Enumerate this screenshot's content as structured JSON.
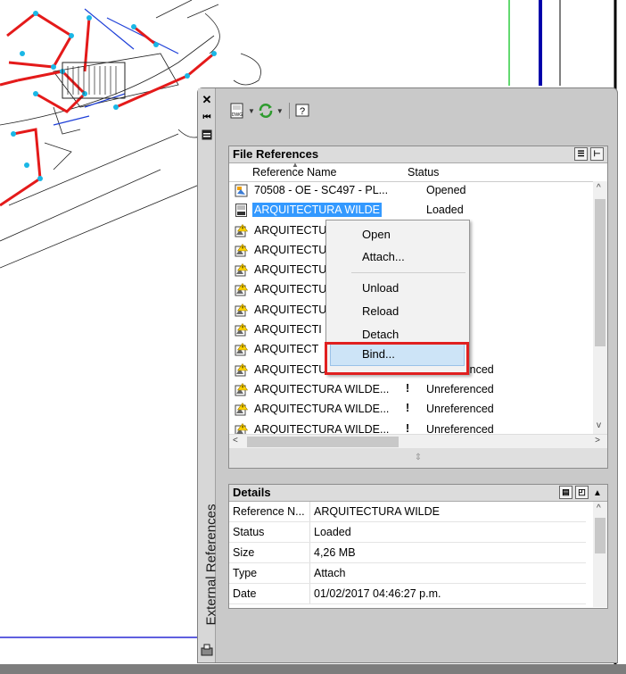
{
  "palette": {
    "title": "External References",
    "toolbar": {
      "attach_icon_text": "DWG",
      "help_glyph": "?"
    },
    "colors": {
      "selection": "#3399ff",
      "highlight_border": "#e02020",
      "drawing_red": "#e41a1a",
      "drawing_blue": "#1e3fd8",
      "drawing_cyan": "#1ab7e6"
    }
  },
  "file_references": {
    "title": "File References",
    "columns": {
      "name": "Reference Name",
      "status": "Status"
    },
    "rows": [
      {
        "name": "70508 - OE - SC497 - PL...",
        "status": "Opened",
        "warn": "",
        "icon": "dwg-host-icon"
      },
      {
        "name": "ARQUITECTURA WILDE",
        "status": "Loaded",
        "warn": "",
        "icon": "dwg-ref-icon",
        "selected": true
      },
      {
        "name": "ARQUITECTU",
        "status": "renced",
        "warn": "",
        "icon": "warning-ref-icon"
      },
      {
        "name": "ARQUITECTU",
        "status": "renced",
        "warn": "",
        "icon": "warning-ref-icon"
      },
      {
        "name": "ARQUITECTU",
        "status": "renced",
        "warn": "",
        "icon": "warning-ref-icon"
      },
      {
        "name": "ARQUITECTU",
        "status": "renced",
        "warn": "",
        "icon": "warning-ref-icon"
      },
      {
        "name": "ARQUITECTU",
        "status": "renced",
        "warn": "",
        "icon": "warning-ref-icon"
      },
      {
        "name": "ARQUITECTI",
        "status": "renced",
        "warn": "",
        "icon": "warning-ref-icon"
      },
      {
        "name": "ARQUITECT",
        "status": "renced",
        "warn": "",
        "icon": "warning-ref-icon"
      },
      {
        "name": "ARQUITECTURA WILDE...",
        "status": "Unreferenced",
        "warn": "!",
        "icon": "warning-ref-icon"
      },
      {
        "name": "ARQUITECTURA WILDE...",
        "status": "Unreferenced",
        "warn": "!",
        "icon": "warning-ref-icon"
      },
      {
        "name": "ARQUITECTURA WILDE...",
        "status": "Unreferenced",
        "warn": "!",
        "icon": "warning-ref-icon"
      },
      {
        "name": "ARQUITECTURA WILDE...",
        "status": "Unreferenced",
        "warn": "!",
        "icon": "warning-ref-icon"
      }
    ]
  },
  "details": {
    "title": "Details",
    "rows": [
      {
        "key": "Reference N...",
        "value": "ARQUITECTURA WILDE"
      },
      {
        "key": "Status",
        "value": "Loaded"
      },
      {
        "key": "Size",
        "value": "4,26 MB"
      },
      {
        "key": "Type",
        "value": "Attach"
      },
      {
        "key": "Date",
        "value": "01/02/2017 04:46:27 p.m."
      }
    ]
  },
  "context_menu": {
    "items": [
      "Open",
      "Attach...",
      "Unload",
      "Reload",
      "Detach",
      "Bind..."
    ],
    "highlighted": "Bind..."
  }
}
